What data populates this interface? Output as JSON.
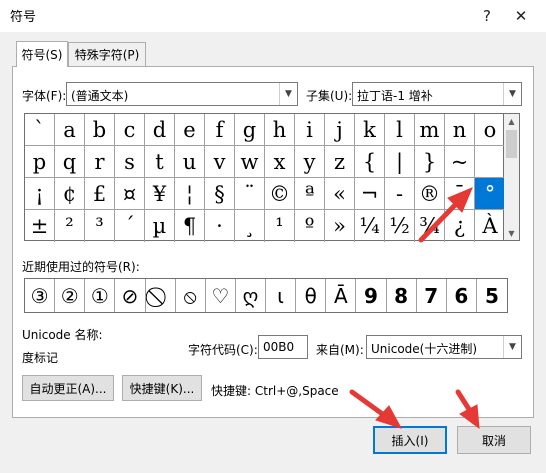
{
  "window": {
    "title": "符号",
    "help_label": "?",
    "close_label": "✕"
  },
  "tabs": [
    {
      "label": "符号(S)"
    },
    {
      "label": "特殊字符(P)"
    }
  ],
  "font": {
    "label": "字体(F):",
    "value": "(普通文本)"
  },
  "subset": {
    "label": "子集(U):",
    "value": "拉丁语-1 增补"
  },
  "symbols": [
    "`",
    "a",
    "b",
    "c",
    "d",
    "e",
    "f",
    "g",
    "h",
    "i",
    "j",
    "k",
    "l",
    "m",
    "n",
    "o",
    "p",
    "q",
    "r",
    "s",
    "t",
    "u",
    "v",
    "w",
    "x",
    "y",
    "z",
    "{",
    "|",
    "}",
    "~",
    " ",
    "¡",
    "¢",
    "£",
    "¤",
    "¥",
    "¦",
    "§",
    "¨",
    "©",
    "ª",
    "«",
    "¬",
    "-",
    "®",
    "¯",
    "°",
    "±",
    "²",
    "³",
    "´",
    "µ",
    "¶",
    "·",
    "¸",
    "¹",
    "º",
    "»",
    "¼",
    "½",
    "¾",
    "¿",
    "À"
  ],
  "selected_symbol": "°",
  "recent": {
    "label": "近期使用过的符号(R):",
    "symbols": [
      "③",
      "②",
      "①",
      "⊘",
      "⃠",
      "⦸",
      "♡",
      "ღ",
      "ι",
      "θ",
      "Ā",
      "9",
      "8",
      "7",
      "6",
      "5"
    ]
  },
  "unicode_name": {
    "label": "Unicode 名称:",
    "value": "度标记"
  },
  "char_code": {
    "label": "字符代码(C):",
    "value": "00B0"
  },
  "from": {
    "label": "来自(M):",
    "value": "Unicode(十六进制)"
  },
  "buttons": {
    "autocorrect": "自动更正(A)...",
    "shortcut_key": "快捷键(K)...",
    "insert": "插入(I)",
    "cancel": "取消"
  },
  "shortcut_text": "快捷键: Ctrl+@,Space",
  "colors": {
    "selection": "#0078d7",
    "annotation_arrow": "#e53935"
  }
}
